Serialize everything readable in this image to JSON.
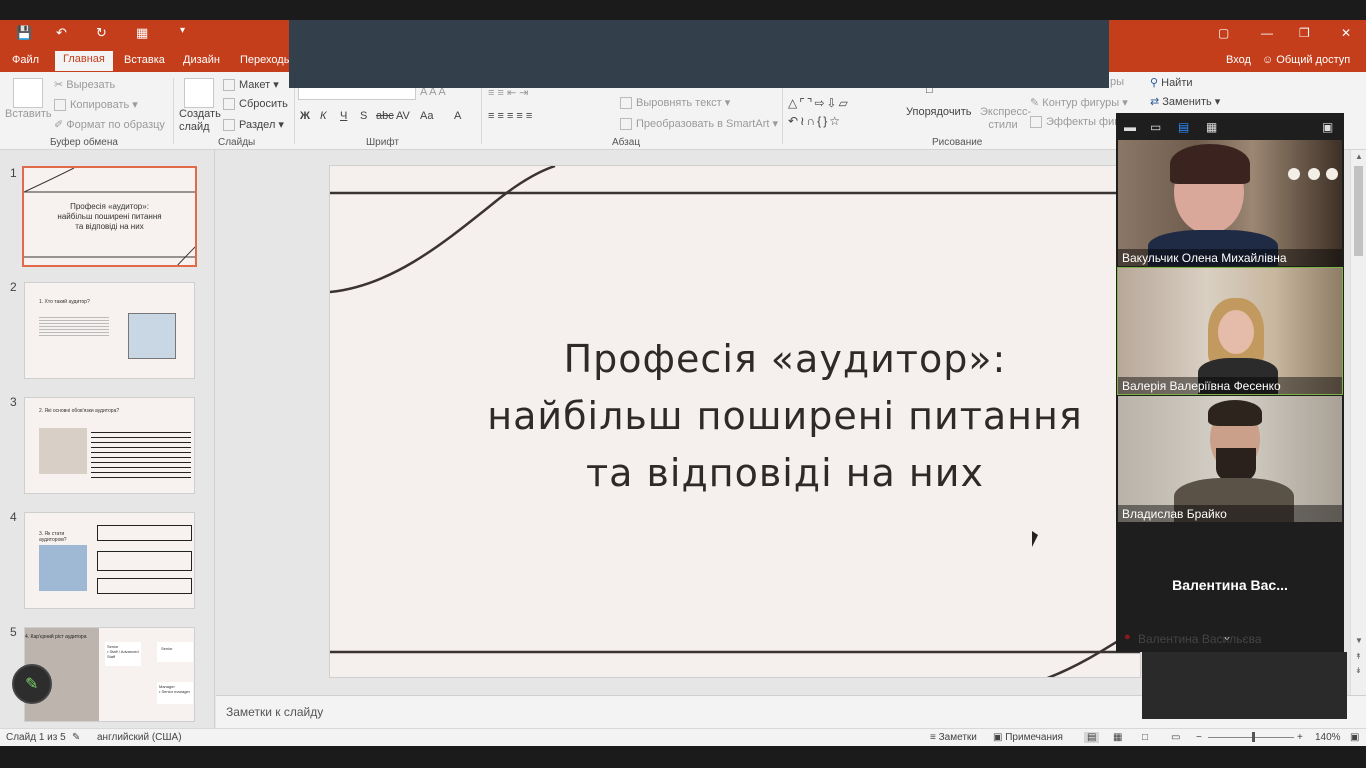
{
  "window": {
    "qat": [
      "save-icon",
      "undo-icon",
      "redo-icon",
      "present-icon",
      "customize-icon"
    ],
    "controls": [
      "▢",
      "—",
      "❐",
      "✕"
    ]
  },
  "tabs": {
    "items": [
      "Файл",
      "Главная",
      "Вставка",
      "Дизайн",
      "Переходы"
    ],
    "active": "Главная",
    "signin": "Вход",
    "share": "Общий доступ"
  },
  "ribbon": {
    "clipboard": {
      "paste": "Вставить",
      "cut": "Вырезать",
      "copy": "Копировать",
      "format": "Формат по образцу",
      "label": "Буфер обмена"
    },
    "slides": {
      "new_slide": "Создать слайд",
      "layout": "Макет",
      "reset": "Сбросить",
      "section": "Раздел",
      "label": "Слайды"
    },
    "font": {
      "buttons": [
        "Ж",
        "К",
        "Ч",
        "S",
        "abc",
        "AV",
        "Aa",
        "A"
      ],
      "label": "Шрифт"
    },
    "paragraph": {
      "align_text": "Выровнять текст",
      "smartart": "Преобразовать в SmartArt",
      "label": "Абзац"
    },
    "drawing": {
      "arrange": "Упорядочить",
      "styles": "Экспресс-стили",
      "outline": "Контур фигуры",
      "effects": "Эффекты фигур",
      "label": "Рисование"
    },
    "editing": {
      "find": "Найти",
      "replace": "Заменить"
    },
    "truncated_ry": "ры"
  },
  "thumbnails": [
    {
      "num": "1",
      "title": "Професія «аудитор»:\nнайбільш поширені питання\nта відповіді на них",
      "selected": true
    },
    {
      "num": "2",
      "title": "1. Хто такий аудитор?",
      "selected": false
    },
    {
      "num": "3",
      "title": "2. Які основні обов'язки аудитора?",
      "selected": false
    },
    {
      "num": "4",
      "title": "3. Як стати аудитором?",
      "selected": false
    },
    {
      "num": "5",
      "title": "4. Кар'єрний ріст аудитора",
      "selected": false
    }
  ],
  "thumb5": {
    "senior": "Senior",
    "staff": "• Staff / Advanced Staff",
    "manager": "Manager",
    "senior_manager": "• Senior manager"
  },
  "slide": {
    "title_line1": "Професія «аудитор»:",
    "title_line2": "найбільш поширені питання",
    "title_line3": "та відповіді на них"
  },
  "notes": {
    "placeholder": "Заметки к слайду"
  },
  "status": {
    "slide_count": "Слайд 1 из 5",
    "language": "английский (США)",
    "notes": "Заметки",
    "comments": "Примечания",
    "zoom": "140%"
  },
  "zoom": {
    "participants": [
      {
        "name": "Вакульчик Олена Михайлівна",
        "active": false
      },
      {
        "name": "Валерія Валеріївна Фесенко",
        "active": true
      },
      {
        "name": "Владислав Брайко",
        "active": false
      }
    ],
    "no_video_name": "Валентина  Вас...",
    "faded_name": "Валентина Васильєва"
  },
  "colors": {
    "accent": "#c43e1c",
    "slide_bg": "#f5f0ed",
    "active_speaker": "#7cb342"
  }
}
